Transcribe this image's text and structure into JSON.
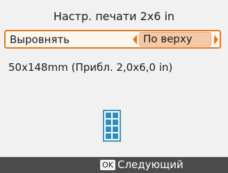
{
  "header": {
    "title": "Настр. печати 2x6 in"
  },
  "setting": {
    "label": "Выровнять",
    "value": "По верху"
  },
  "size_info": "50x148mm (Прибл. 2,0x6,0 in)",
  "layout_preview": {
    "icon": "print-layout-grid-icon"
  },
  "footer": {
    "ok_label": "OK",
    "next_label": "Следующий"
  },
  "colors": {
    "accent": "#e07a1f",
    "selected_value_bg": "#f6c9a6",
    "preview_blue": "#2f8dbc",
    "footer_bg": "#4b4b4b"
  }
}
